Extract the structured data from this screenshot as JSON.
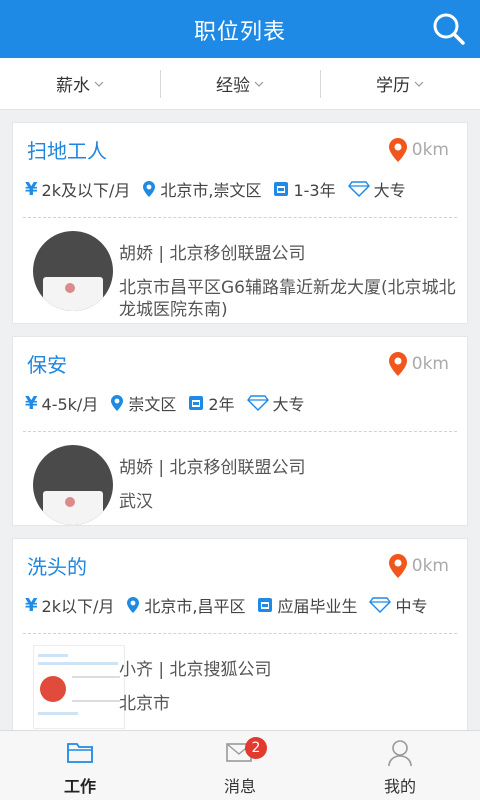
{
  "header": {
    "title": "职位列表"
  },
  "filters": [
    "薪水",
    "经验",
    "学历"
  ],
  "jobs": [
    {
      "title": "扫地工人",
      "distance": "0km",
      "salary": "2k及以下/月",
      "location": "北京市,崇文区",
      "experience": "1-3年",
      "education": "大专",
      "contact": "胡娇 | 北京移创联盟公司",
      "address": "北京市昌平区G6辅路靠近新龙大厦(北京城北龙城医院东南)"
    },
    {
      "title": "保安",
      "distance": "0km",
      "salary": "4-5k/月",
      "location": "崇文区",
      "experience": "2年",
      "education": "大专",
      "contact": "胡娇 | 北京移创联盟公司",
      "address": "武汉"
    },
    {
      "title": "洗头的",
      "distance": "0km",
      "salary": "2k以下/月",
      "location": "北京市,昌平区",
      "experience": "应届毕业生",
      "education": "中专",
      "contact": "小齐 | 北京搜狐公司",
      "address": "北京市"
    }
  ],
  "tabbar": {
    "items": [
      {
        "label": "工作",
        "icon": "folder-icon"
      },
      {
        "label": "消息",
        "icon": "message-icon",
        "badge": "2"
      },
      {
        "label": "我的",
        "icon": "user-icon"
      }
    ]
  },
  "colors": {
    "primary": "#1e8ae5",
    "location_pin": "#f2561d",
    "badge": "#e23a2f"
  }
}
